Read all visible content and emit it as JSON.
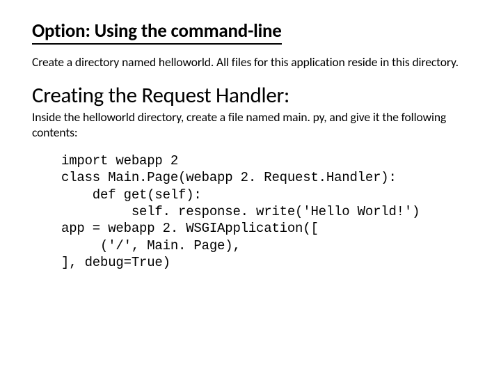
{
  "heading1": "Option: Using the command-line",
  "para1": "Create a directory named helloworld. All files for this application reside in this directory.",
  "heading2": "Creating the Request Handler:",
  "para2": "Inside the helloworld directory, create a file named main. py, and give it the following contents:",
  "code": "import webapp 2\nclass Main.Page(webapp 2. Request.Handler):\n    def get(self):\n         self. response. write('Hello World!')\napp = webapp 2. WSGIApplication([\n     ('/', Main. Page),\n], debug=True)"
}
